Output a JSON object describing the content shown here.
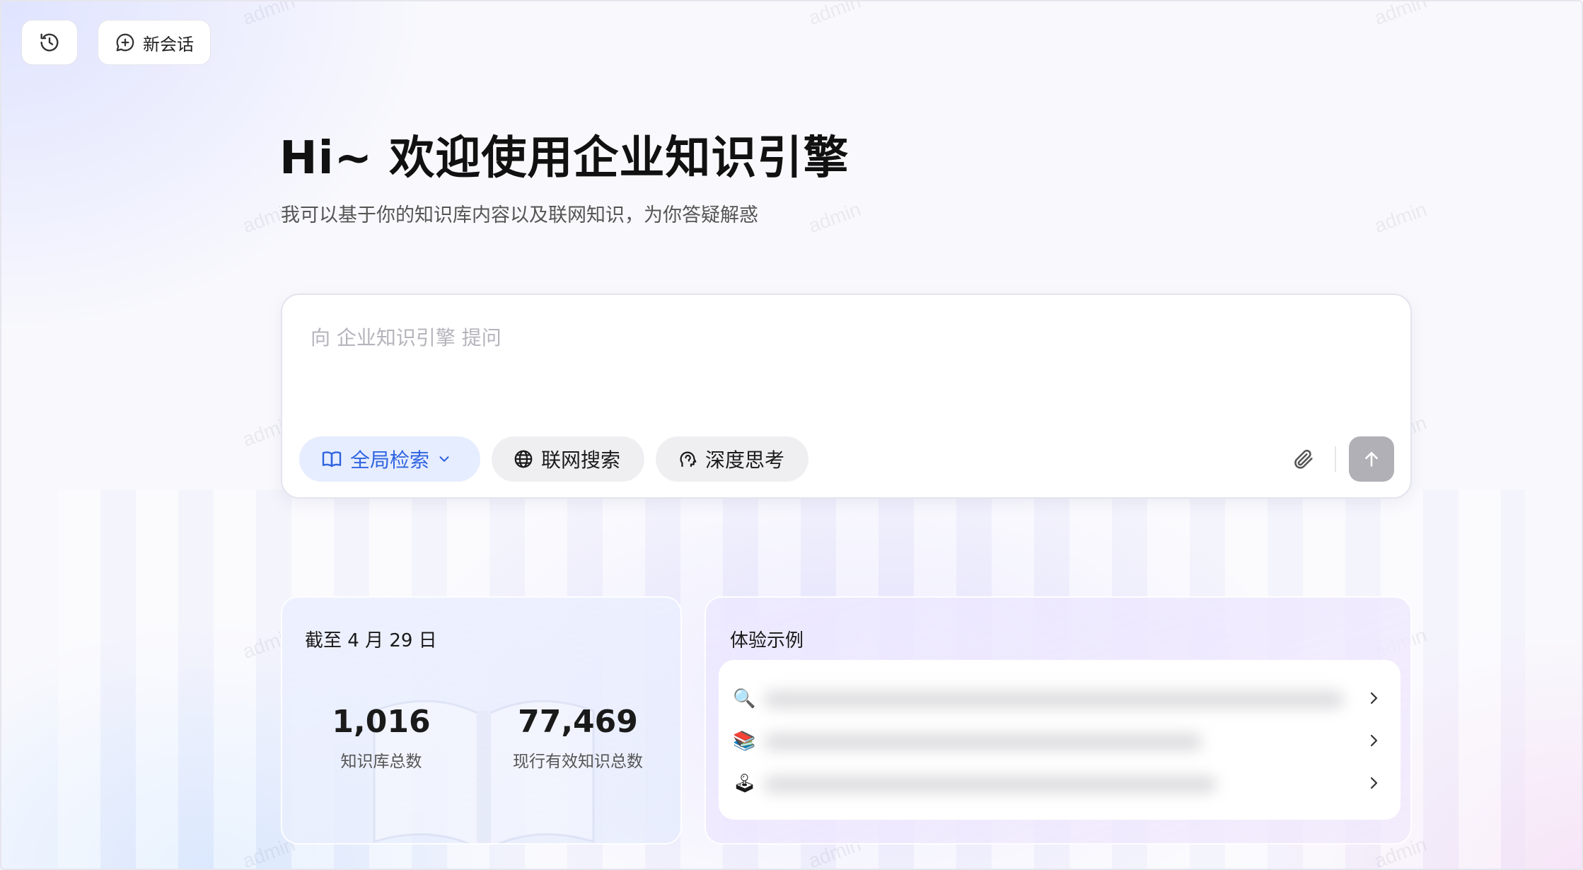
{
  "toolbar": {
    "history_icon": "history-clock-icon",
    "new_chat_label": "新会话"
  },
  "welcome": {
    "title": "Hi~ 欢迎使用企业知识引擎",
    "subtitle": "我可以基于你的知识库内容以及联网知识，为你答疑解惑"
  },
  "composer": {
    "placeholder": "向 企业知识引擎 提问",
    "value": "",
    "scope_label": "全局检索",
    "web_search_label": "联网搜索",
    "deep_think_label": "深度思考",
    "accent_color": "#2f63e0"
  },
  "stats": {
    "date_label": "截至 4 月 29 日",
    "items": [
      {
        "value": "1,016",
        "label": "知识库总数"
      },
      {
        "value": "77,469",
        "label": "现行有效知识总数"
      }
    ]
  },
  "examples": {
    "title": "体验示例",
    "items": [
      {
        "icon": "🔍"
      },
      {
        "icon": "📚"
      },
      {
        "icon": "🕹"
      }
    ]
  },
  "watermark": "admin"
}
